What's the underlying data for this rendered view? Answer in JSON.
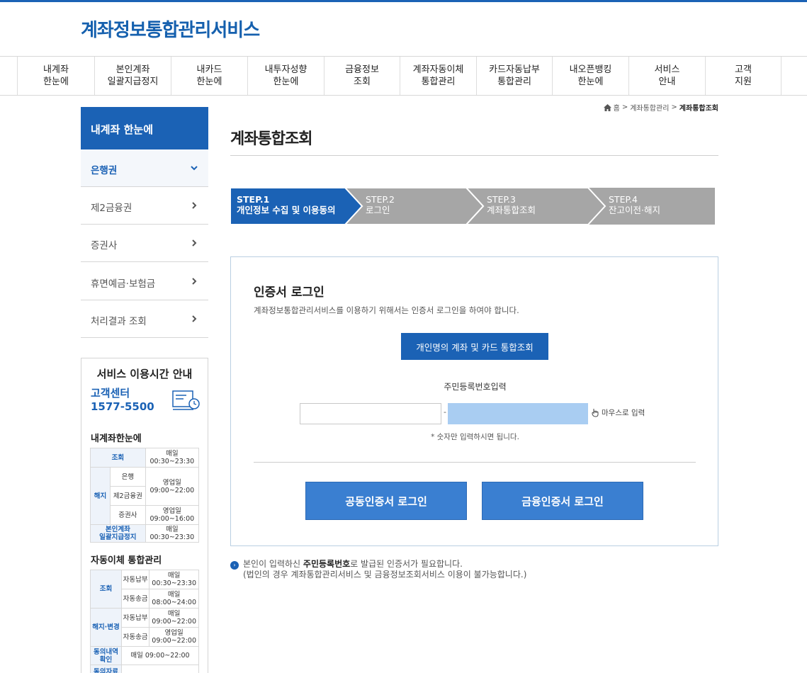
{
  "site": {
    "logo": "계좌정보통합관리서비스",
    "accent": "#1b62b5"
  },
  "gnb": [
    {
      "label": "내계좌\n한눈에"
    },
    {
      "label": "본인계좌\n일괄지급정지"
    },
    {
      "label": "내카드\n한눈에"
    },
    {
      "label": "내투자성향\n한눈에"
    },
    {
      "label": "금융정보\n조회"
    },
    {
      "label": "계좌자동이체\n통합관리"
    },
    {
      "label": "카드자동납부\n통합관리"
    },
    {
      "label": "내오픈뱅킹\n한눈에"
    },
    {
      "label": "서비스\n안내"
    },
    {
      "label": "고객\n지원"
    }
  ],
  "lnb": {
    "title": "내계좌 한눈에",
    "items": [
      {
        "label": "은행권"
      },
      {
        "label": "제2금융권"
      },
      {
        "label": "증권사"
      },
      {
        "label": "휴면예금·보험금"
      },
      {
        "label": "처리결과 조회"
      }
    ]
  },
  "service_info": {
    "title": "서비스 이용시간 안내",
    "cc_label": "고객센터",
    "cc_phone": "1577-5500",
    "section1": {
      "title": "내계좌한눈에",
      "lookup": "조회",
      "lookup_time": "매일\n00:30~23:30",
      "cancel": "해지",
      "bank": "은행",
      "second": "제2금융권",
      "weekday": "영업일\n09:00~22:00",
      "securities": "증권사",
      "sec_time": "영업일\n09:00~16:00",
      "stop": "본인계좌\n일괄지급정지",
      "stop_time": "매일\n00:30~23:30"
    },
    "section2": {
      "title": "자동이체 통합관리",
      "lookup": "조회",
      "auto_pay": "자동납부",
      "auto_pay_time": "매일\n00:30~23:30",
      "auto_send": "자동송금",
      "auto_send_time": "매일\n08:00~24:00",
      "change": "해지·변경",
      "auto_pay2_time": "매일\n09:00~22:00",
      "auto_send2_time": "영업일\n09:00~22:00",
      "consent": "동의내역\n확인",
      "consent_time": "매일 09:00~22:00",
      "more": "동의자료"
    }
  },
  "breadcrumb": {
    "home": "홈",
    "sep": ">",
    "level1": "계좌통합관리",
    "current": "계좌통합조회"
  },
  "page": {
    "title": "계좌통합조회"
  },
  "steps": [
    {
      "label": "STEP.1\n개인정보 수집 및 이용동의",
      "active": true
    },
    {
      "label": "STEP.2\n로그인",
      "active": false
    },
    {
      "label": "STEP.3\n계좌통합조회",
      "active": false
    },
    {
      "label": "STEP.4\n잔고이전·해지",
      "active": false
    }
  ],
  "login": {
    "title": "인증서 로그인",
    "desc": "계좌정보통합관리서비스를 이용하기 위해서는 인증서 로그인을 하여야 합니다.",
    "personal_button": "개인명의 계좌 및 카드 통합조회",
    "rrn_label": "주민등록번호입력",
    "rrn_first_value": "",
    "rrn_dash": "-",
    "mouse_label": "마우스로 입력",
    "rrn_note": "* 숫자만 입력하시면 됩니다.",
    "joint_cert_button": "공동인증서 로그인",
    "fin_cert_button": "금융인증서 로그인"
  },
  "notice": {
    "prefix": "본인이 입력하신 ",
    "bold": "주민등록번호",
    "suffix": "로 발급된 인증서가 필요합니다.",
    "line2": "(법인의 경우 계좌통합관리서비스 및 금융정보조회서비스 이용이 불가능합니다.)"
  }
}
